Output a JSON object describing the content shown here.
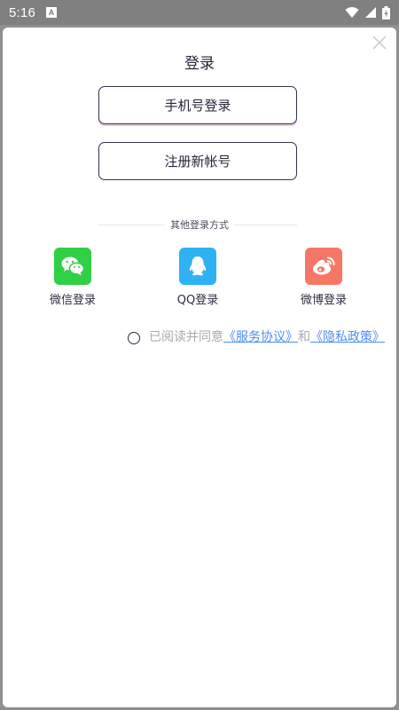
{
  "status_bar": {
    "time": "5:16",
    "notification_icon": "a-notification-icon",
    "icons": [
      "wifi-icon",
      "signal-icon",
      "battery-icon"
    ]
  },
  "dialog": {
    "title": "登录",
    "close_icon": "close-icon",
    "phone_login_label": "手机号登录",
    "register_label": "注册新帐号",
    "other_login_label": "其他登录方式",
    "social": [
      {
        "label": "微信登录",
        "icon": "wechat-icon",
        "color": "#2fcf46"
      },
      {
        "label": "QQ登录",
        "icon": "qq-icon",
        "color": "#2eb2f3"
      },
      {
        "label": "微博登录",
        "icon": "weibo-icon",
        "color": "#f77766"
      }
    ],
    "agreement": {
      "prefix": "已阅读并同意",
      "service_link": "《服务协议》",
      "and": "和",
      "privacy_link": "《隐私政策》"
    }
  },
  "colors": {
    "button_border": "#30344f",
    "link": "#4d8ef2",
    "status_bar": "#808080"
  }
}
